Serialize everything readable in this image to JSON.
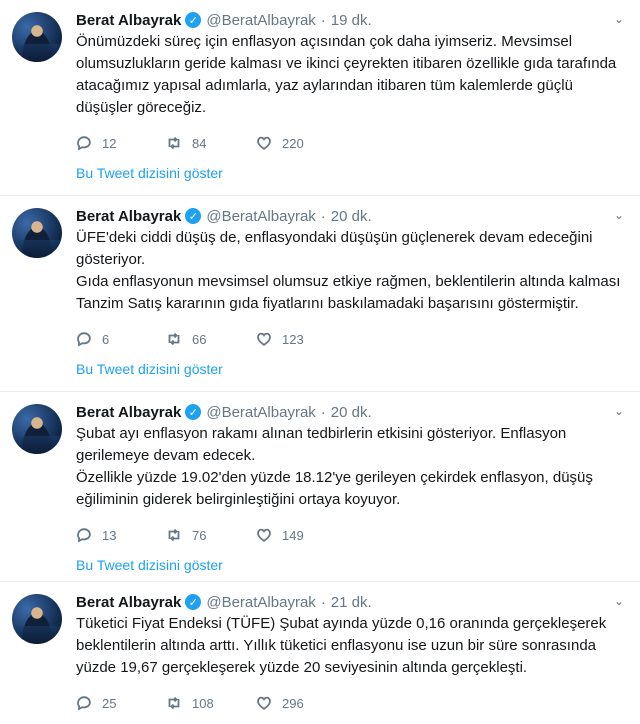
{
  "tweets": [
    {
      "name": "Berat Albayrak",
      "handle": "@BeratAlbayrak",
      "separator": "·",
      "time": "19 dk.",
      "lines": [
        "Önümüzdeki süreç için enflasyon açısından çok daha iyimseriz. Mevsimsel",
        "olumsuzlukların geride kalması ve ikinci çeyrekten itibaren özellikle gıda tarafında",
        "atacağımız yapısal adımlarla, yaz aylarından itibaren tüm kalemlerde güçlü",
        "düşüşler göreceğiz."
      ],
      "replies": "12",
      "retweets": "84",
      "likes": "220",
      "show_thread": "Bu Tweet dizisini göster"
    },
    {
      "name": "Berat Albayrak",
      "handle": "@BeratAlbayrak",
      "separator": "·",
      "time": "20 dk.",
      "lines": [
        "ÜFE'deki ciddi düşüş de, enflasyondaki düşüşün güçlenerek devam edeceğini",
        "gösteriyor.",
        "Gıda enflasyonun mevsimsel olumsuz etkiye rağmen, beklentilerin altında kalması",
        "Tanzim Satış kararının gıda fiyatlarını baskılamadaki başarısını göstermiştir."
      ],
      "replies": "6",
      "retweets": "66",
      "likes": "123",
      "show_thread": "Bu Tweet dizisini göster"
    },
    {
      "name": "Berat Albayrak",
      "handle": "@BeratAlbayrak",
      "separator": "·",
      "time": "20 dk.",
      "lines": [
        "Şubat ayı enflasyon rakamı alınan tedbirlerin etkisini gösteriyor. Enflasyon",
        "gerilemeye devam edecek.",
        "Özellikle yüzde 19.02'den yüzde 18.12'ye gerileyen çekirdek enflasyon, düşüş",
        "eğiliminin giderek belirginleştiğini ortaya koyuyor."
      ],
      "replies": "13",
      "retweets": "76",
      "likes": "149",
      "show_thread": "Bu Tweet dizisini göster"
    },
    {
      "name": "Berat Albayrak",
      "handle": "@BeratAlbayrak",
      "separator": "·",
      "time": "21 dk.",
      "lines": [
        "Tüketici Fiyat Endeksi (TÜFE) Şubat ayında yüzde 0,16 oranında gerçekleşerek",
        "beklentilerin altında arttı. Yıllık tüketici enflasyonu ise uzun bir süre sonrasında",
        "yüzde 19,67 gerçekleşerek yüzde 20 seviyesinin altında gerçekleşti."
      ],
      "replies": "25",
      "retweets": "108",
      "likes": "296"
    }
  ],
  "colors": {
    "accent": "#1da1f2",
    "muted": "#657786",
    "text": "#14171a",
    "divider": "#e6ecf0"
  },
  "icons": {
    "reply": "reply-icon",
    "retweet": "retweet-icon",
    "like": "heart-icon",
    "verified": "verified-badge-icon",
    "menu": "chevron-down-icon"
  }
}
